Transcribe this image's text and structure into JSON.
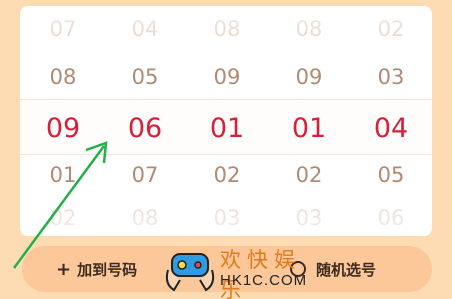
{
  "picker": {
    "columns": [
      {
        "rows": [
          "07",
          "08",
          "09",
          "01",
          "02"
        ]
      },
      {
        "rows": [
          "04",
          "05",
          "06",
          "07",
          "08"
        ]
      },
      {
        "rows": [
          "08",
          "09",
          "01",
          "02",
          "03"
        ]
      },
      {
        "rows": [
          "08",
          "09",
          "01",
          "02",
          "03"
        ]
      },
      {
        "rows": [
          "02",
          "03",
          "04",
          "05",
          "06"
        ]
      }
    ],
    "selected_color": "#d6203a"
  },
  "actions": {
    "add_icon": "+",
    "add_label": "加到号码",
    "random_label": "随机选号"
  },
  "watermark": {
    "cn": "欢快娱乐",
    "en": "HK1C.COM"
  },
  "icons": {
    "add": "plus-icon",
    "random": "shuffle-icon",
    "annotation": "arrow-icon"
  }
}
